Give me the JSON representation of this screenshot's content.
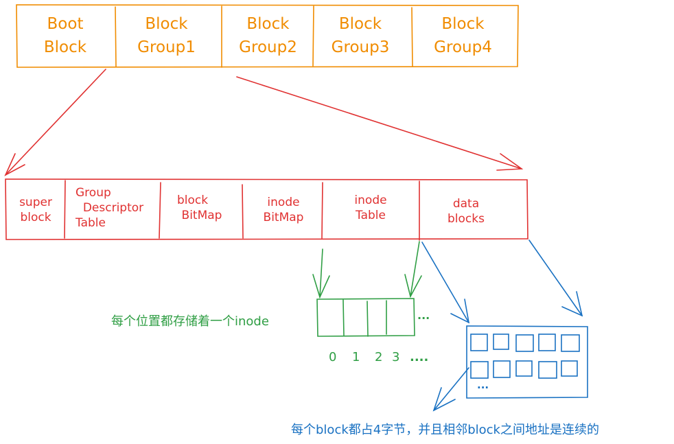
{
  "colors": {
    "disk": "#f08c00",
    "group": "#e03131",
    "inode": "#2f9e44",
    "data": "#1971c2"
  },
  "disk_layout": {
    "cells": [
      {
        "line1": "Boot",
        "line2": "Block"
      },
      {
        "line1": "Block",
        "line2": "Group1"
      },
      {
        "line1": "Block",
        "line2": "Group2"
      },
      {
        "line1": "Block",
        "line2": "Group3"
      },
      {
        "line1": "Block",
        "line2": "Group4"
      }
    ]
  },
  "block_group": {
    "cells": [
      {
        "lines": [
          "super",
          "block"
        ]
      },
      {
        "lines": [
          "Group",
          "Descriptor",
          "Table"
        ]
      },
      {
        "lines": [
          "block",
          "BitMap"
        ]
      },
      {
        "lines": [
          "inode",
          "BitMap"
        ]
      },
      {
        "lines": [
          "inode",
          "Table"
        ]
      },
      {
        "lines": [
          "data",
          "blocks"
        ]
      }
    ]
  },
  "inode_table": {
    "note": "每个位置都存储着一个inode",
    "slot_count": 4,
    "ellipsis": "...",
    "indices": [
      "0",
      "1",
      "2",
      "3",
      "...."
    ]
  },
  "data_blocks": {
    "row_count": 2,
    "blocks_per_row": 5,
    "ellipsis": "...",
    "note": "每个block都占4字节，并且相邻block之间地址是连续的"
  }
}
